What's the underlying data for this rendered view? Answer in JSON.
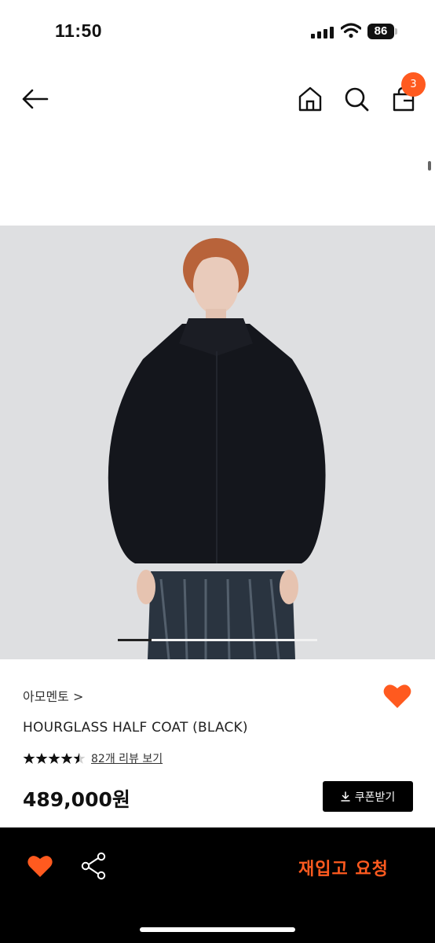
{
  "status_bar": {
    "time": "11:50",
    "battery": "86"
  },
  "header": {
    "cart_count": "3"
  },
  "product": {
    "brand": "아모멘토 >",
    "name": "HOURGLASS HALF COAT (BLACK)",
    "rating": 4.5,
    "review_text": "82개 리뷰 보기",
    "price": "489,000원",
    "coupon_label": "쿠폰받기"
  },
  "carousel": {
    "progress": 0.17
  },
  "bottom_bar": {
    "restock_label": "재입고 요청"
  },
  "colors": {
    "accent": "#ff5a1f",
    "image_bg": "#dedfe1",
    "coat": "#14161c"
  }
}
